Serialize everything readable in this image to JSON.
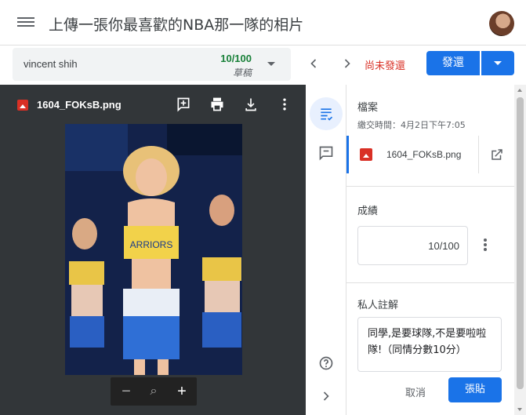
{
  "header": {
    "title": "上傳一張你最喜歡的NBA那一隊的相片",
    "menu_icon": "menu-icon",
    "avatar_icon": "user-avatar"
  },
  "student": {
    "name": "vincent shih",
    "grade": "10/100",
    "status": "草稿"
  },
  "toolbar": {
    "status_text": "尚未發還",
    "return_label": "發還",
    "colors": {
      "accent": "#1a73e8",
      "status": "#d93025",
      "grade": "#188038"
    }
  },
  "viewer": {
    "filename": "1604_FOKsB.png",
    "icons": [
      "add-comment-icon",
      "print-icon",
      "download-icon",
      "more-vert-icon"
    ],
    "zoom": {
      "out": "−",
      "reset": "⌕",
      "in": "+"
    }
  },
  "panel": {
    "files_title": "檔案",
    "submitted_at": "繳交時間：4月2日下午7:05",
    "file_name": "1604_FOKsB.png",
    "grade_title": "成績",
    "grade_value": "10/100",
    "notes_title": "私人註解",
    "note_text": "同學,是要球隊,不是要啦啦隊!（同情分數10分）",
    "cancel_label": "取消",
    "post_label": "張貼"
  }
}
